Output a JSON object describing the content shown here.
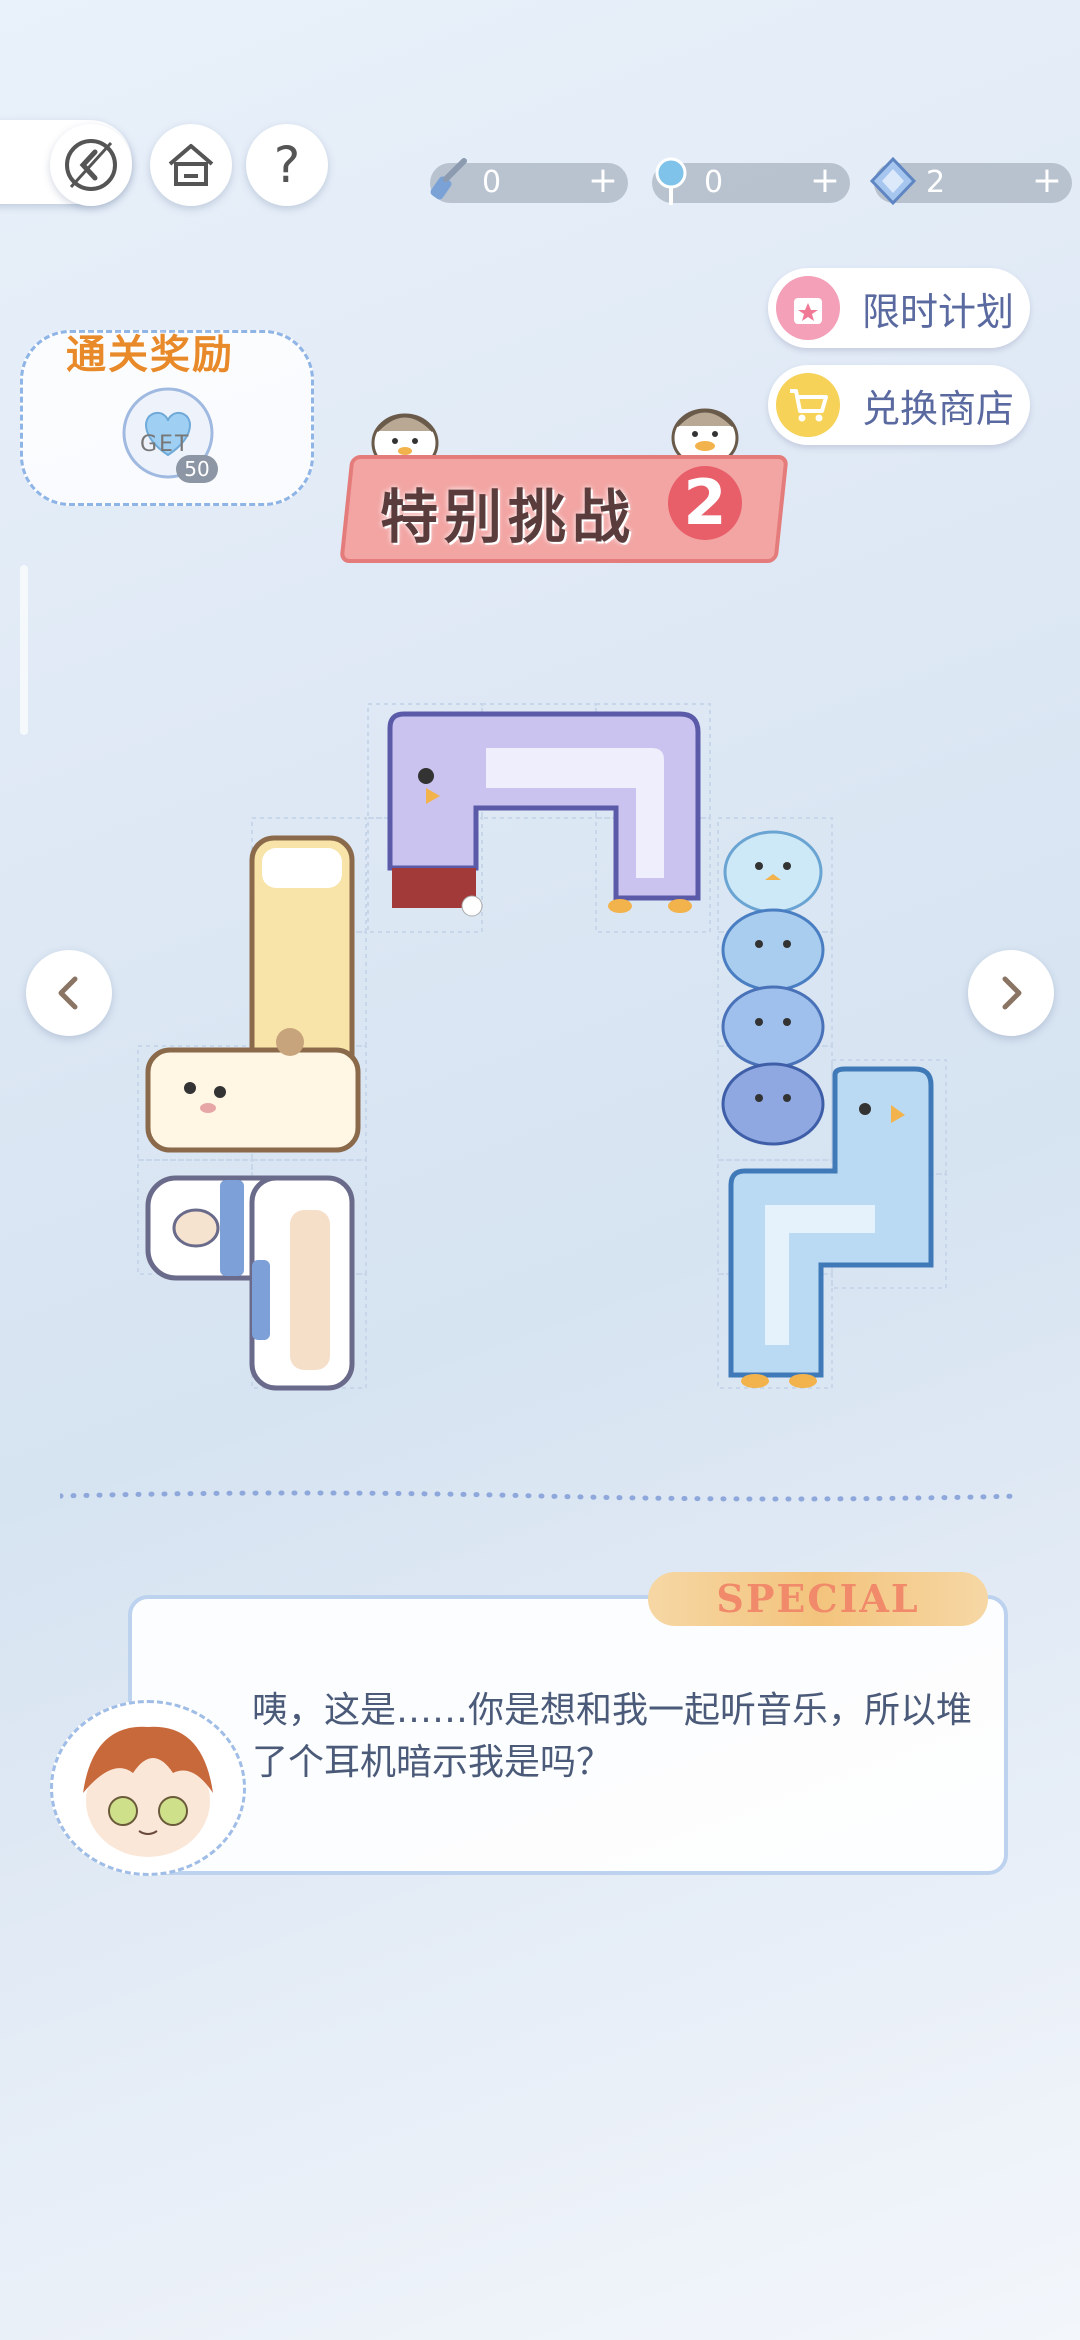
{
  "top_bar": {
    "back_icon": "back-arrow-icon",
    "home_icon": "home-icon",
    "help_label": "?"
  },
  "resources": [
    {
      "icon": "brush-icon",
      "value": "0",
      "plus": "+"
    },
    {
      "icon": "lollipop-icon",
      "value": "0",
      "plus": "+"
    },
    {
      "icon": "diamond-icon",
      "value": "2",
      "plus": "+"
    }
  ],
  "actions": {
    "limited_plan": "限时计划",
    "exchange_shop": "兑换商店"
  },
  "reward": {
    "title": "通关奖励",
    "get_label": "GET",
    "count": "50"
  },
  "level": {
    "title": "特别挑战",
    "number": "2"
  },
  "dialog": {
    "tag": "SPECIAL",
    "text": "咦，这是……你是想和我一起听音乐，所以堆了个耳机暗示我是吗？"
  },
  "colors": {
    "accent_pink": "#e85f6a",
    "text_blue": "#5a6aa0",
    "reward_orange": "#e88a2a"
  }
}
